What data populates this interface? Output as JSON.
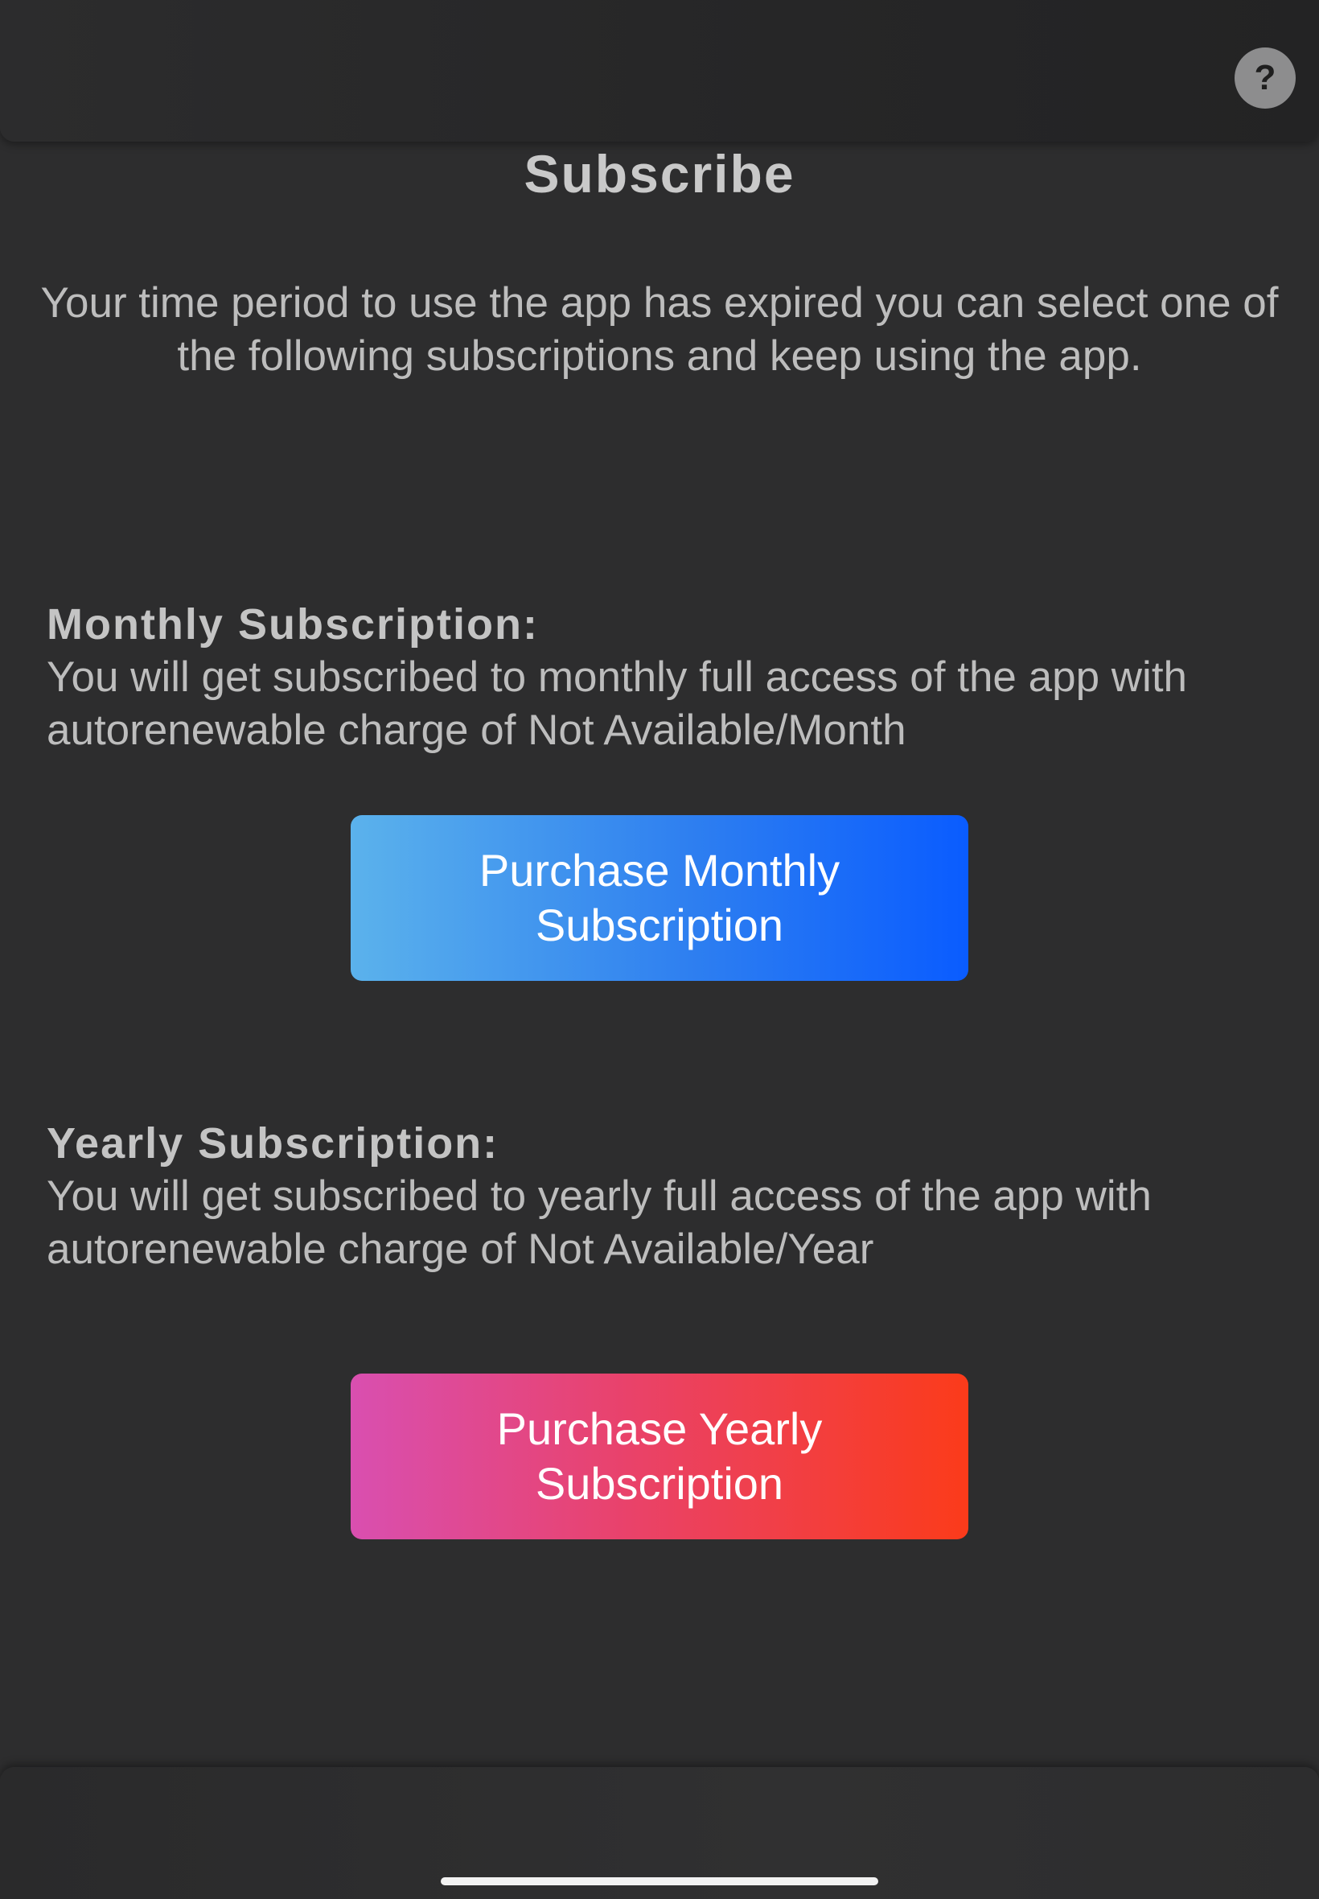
{
  "header": {
    "help_label": "?"
  },
  "title": "Subscribe",
  "intro": "Your time period to use the app has expired you can select one of the following subscriptions and keep using the app.",
  "monthly": {
    "heading": "Monthly Subscription:",
    "description": "You will get subscribed to monthly full access of the app with autorenewable charge of Not Available/Month",
    "button_label": "Purchase Monthly Subscription"
  },
  "yearly": {
    "heading": "Yearly Subscription:",
    "description": "You will get subscribed to yearly full access of the app with autorenewable charge of Not Available/Year",
    "button_label": "Purchase Yearly Subscription"
  },
  "colors": {
    "background": "#2d2d2e",
    "monthly_gradient_start": "#5bb2ec",
    "monthly_gradient_end": "#0a5cff",
    "yearly_gradient_start": "#d94fb0",
    "yearly_gradient_end": "#fb3b1a"
  },
  "icons": {
    "help": "help-icon",
    "home_indicator": "home-indicator"
  }
}
